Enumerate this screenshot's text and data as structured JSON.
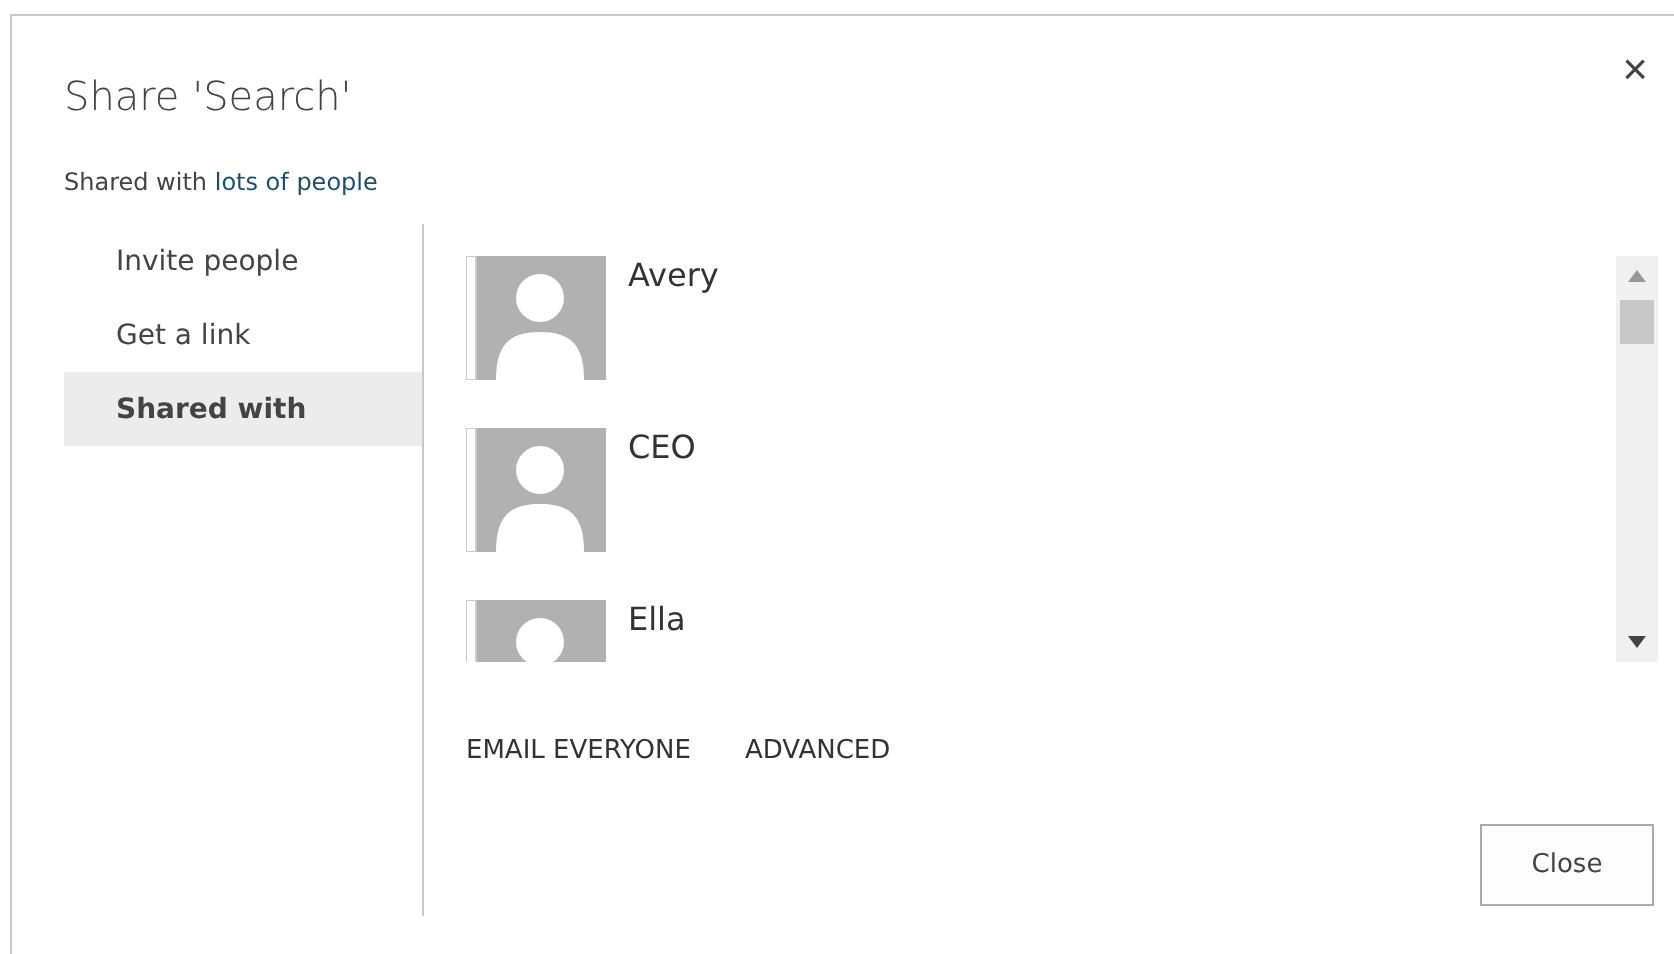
{
  "dialog": {
    "title": "Share 'Search'",
    "close_icon": "×",
    "subtitle": "Shared with",
    "subtitle_link": "lots of people"
  },
  "nav": [
    {
      "label": "Invite people",
      "selected": false
    },
    {
      "label": "Get a link",
      "selected": false
    },
    {
      "label": "Shared with",
      "selected": true
    }
  ],
  "people": [
    {
      "name": "Avery"
    },
    {
      "name": "CEO"
    },
    {
      "name": "Ella"
    }
  ],
  "actions": [
    "EMAIL EVERYONE",
    "ADVANCED"
  ],
  "buttons": [
    "Close"
  ]
}
